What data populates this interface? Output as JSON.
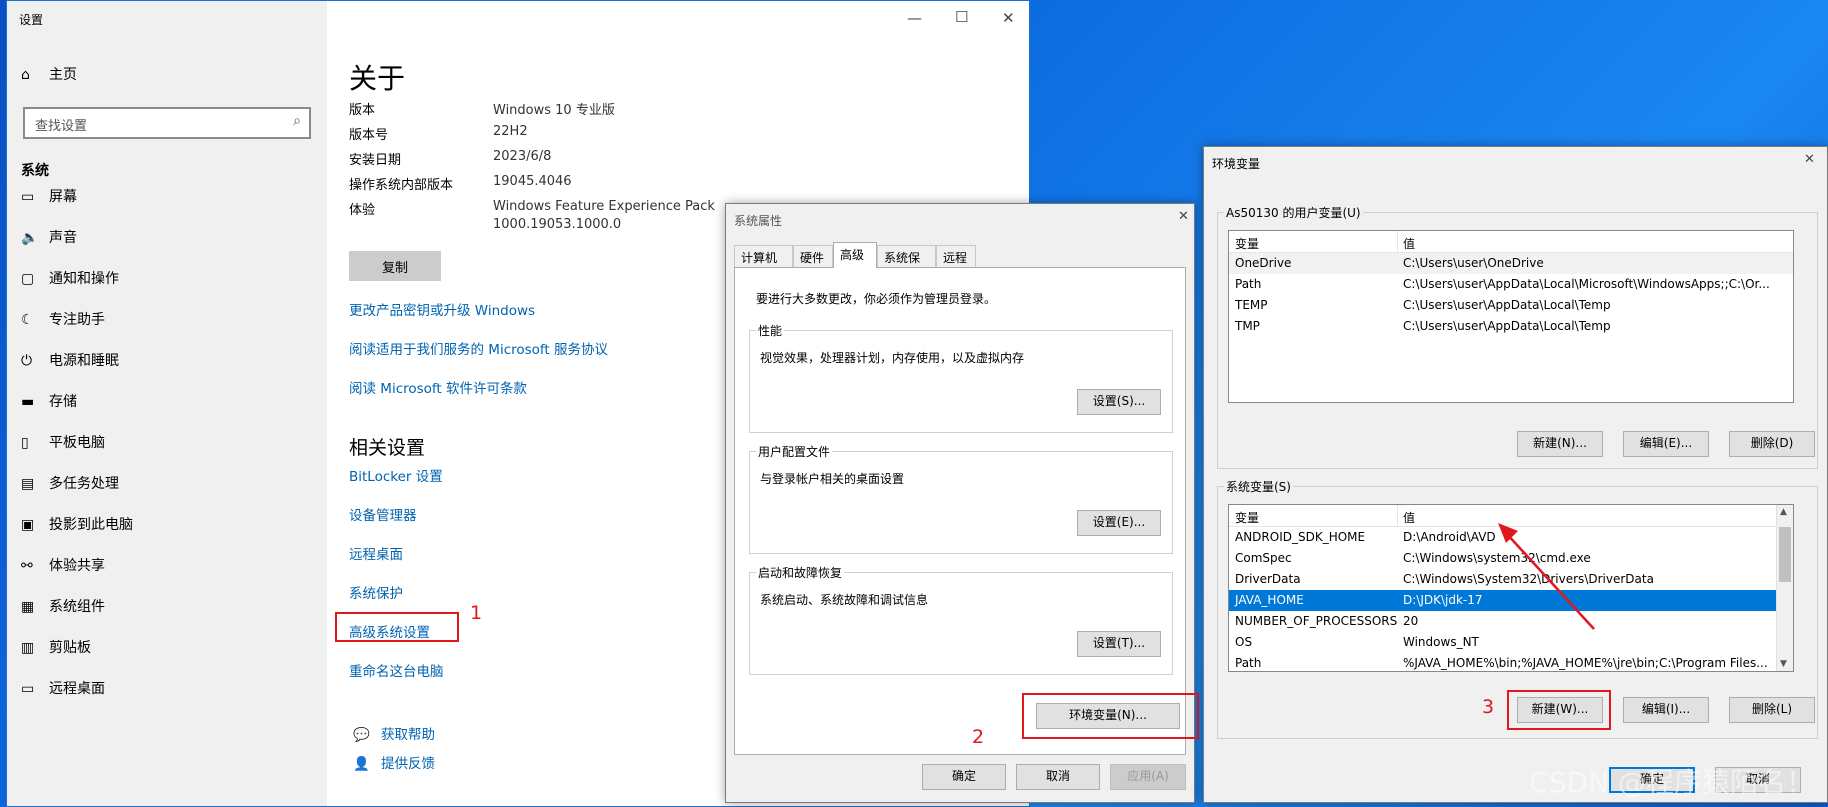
{
  "settings": {
    "title": "设置",
    "controls": {
      "min": "—",
      "max": "☐",
      "close": "✕"
    },
    "home_label": "主页",
    "search_placeholder": "查找设置",
    "section_label": "系统",
    "nav_items": [
      {
        "icon": "display-icon",
        "glyph": "▭",
        "label": "屏幕"
      },
      {
        "icon": "speaker-icon",
        "glyph": "🔈",
        "label": "声音"
      },
      {
        "icon": "notification-icon",
        "glyph": "▢",
        "label": "通知和操作"
      },
      {
        "icon": "moon-icon",
        "glyph": "☾",
        "label": "专注助手"
      },
      {
        "icon": "power-icon",
        "glyph": "⏻",
        "label": "电源和睡眠"
      },
      {
        "icon": "storage-icon",
        "glyph": "▬",
        "label": "存储"
      },
      {
        "icon": "tablet-icon",
        "glyph": "▯",
        "label": "平板电脑"
      },
      {
        "icon": "multitask-icon",
        "glyph": "▤",
        "label": "多任务处理"
      },
      {
        "icon": "project-icon",
        "glyph": "▣",
        "label": "投影到此电脑"
      },
      {
        "icon": "share-icon",
        "glyph": "⚯",
        "label": "体验共享"
      },
      {
        "icon": "components-icon",
        "glyph": "▦",
        "label": "系统组件"
      },
      {
        "icon": "clipboard-icon",
        "glyph": "▥",
        "label": "剪贴板"
      },
      {
        "icon": "remote-icon",
        "glyph": "▭",
        "label": "远程桌面"
      }
    ],
    "main": {
      "title": "关于",
      "specs": [
        {
          "label": "版本",
          "value": "Windows 10 专业版"
        },
        {
          "label": "版本号",
          "value": "22H2"
        },
        {
          "label": "安装日期",
          "value": "2023/6/8"
        },
        {
          "label": "操作系统内部版本",
          "value": "19045.4046"
        },
        {
          "label": "体验",
          "value": "Windows Feature Experience Pack",
          "value2": "1000.19053.1000.0"
        }
      ],
      "copy_label": "复制",
      "links": [
        "更改产品密钥或升级 Windows",
        "阅读适用于我们服务的 Microsoft 服务协议",
        "阅读 Microsoft 软件许可条款"
      ],
      "related_title": "相关设置",
      "related_links": [
        "BitLocker 设置",
        "设备管理器",
        "远程桌面",
        "系统保护",
        "高级系统设置",
        "重命名这台电脑"
      ],
      "help_links": [
        {
          "icon": "help-icon",
          "glyph": "💬",
          "label": "获取帮助"
        },
        {
          "icon": "feedback-icon",
          "glyph": "👤",
          "label": "提供反馈"
        }
      ]
    }
  },
  "sysprops": {
    "title": "系统属性",
    "close": "✕",
    "tabs": [
      "计算机名",
      "硬件",
      "高级",
      "系统保护",
      "远程"
    ],
    "admin_notice": "要进行大多数更改，你必须作为管理员登录。",
    "groups": [
      {
        "title": "性能",
        "desc": "视觉效果，处理器计划，内存使用，以及虚拟内存",
        "button": "设置(S)..."
      },
      {
        "title": "用户配置文件",
        "desc": "与登录帐户相关的桌面设置",
        "button": "设置(E)..."
      },
      {
        "title": "启动和故障恢复",
        "desc": "系统启动、系统故障和调试信息",
        "button": "设置(T)..."
      }
    ],
    "env_button": "环境变量(N)...",
    "ok": "确定",
    "cancel": "取消",
    "apply": "应用(A)"
  },
  "envvars": {
    "title": "环境变量",
    "close": "✕",
    "user_section": "As50130 的用户变量(U)",
    "col_var": "变量",
    "col_val": "值",
    "user_vars": [
      {
        "name": "OneDrive",
        "value": "C:\\Users\\user\\OneDrive"
      },
      {
        "name": "Path",
        "value": "C:\\Users\\user\\AppData\\Local\\Microsoft\\WindowsApps;;C:\\Or..."
      },
      {
        "name": "TEMP",
        "value": "C:\\Users\\user\\AppData\\Local\\Temp"
      },
      {
        "name": "TMP",
        "value": "C:\\Users\\user\\AppData\\Local\\Temp"
      }
    ],
    "user_buttons": [
      "新建(N)...",
      "编辑(E)...",
      "删除(D)"
    ],
    "sys_section": "系统变量(S)",
    "sys_vars": [
      {
        "name": "ANDROID_SDK_HOME",
        "value": "D:\\Android\\AVD"
      },
      {
        "name": "ComSpec",
        "value": "C:\\Windows\\system32\\cmd.exe"
      },
      {
        "name": "DriverData",
        "value": "C:\\Windows\\System32\\Drivers\\DriverData"
      },
      {
        "name": "JAVA_HOME",
        "value": "D:\\JDK\\jdk-17"
      },
      {
        "name": "NUMBER_OF_PROCESSORS",
        "value": "20"
      },
      {
        "name": "OS",
        "value": "Windows_NT"
      },
      {
        "name": "Path",
        "value": "%JAVA_HOME%\\bin;%JAVA_HOME%\\jre\\bin;C:\\Program Files..."
      }
    ],
    "sys_buttons": [
      "新建(W)...",
      "编辑(I)...",
      "删除(L)"
    ],
    "ok": "确定",
    "cancel": "取消"
  },
  "annotations": {
    "step1": "1",
    "step2": "2",
    "step3": "3"
  },
  "watermark": "CSDN @程序猿陌名！",
  "colors": {
    "accent": "#0078d7",
    "link": "#0063b1",
    "highlight": "#e0181d"
  }
}
